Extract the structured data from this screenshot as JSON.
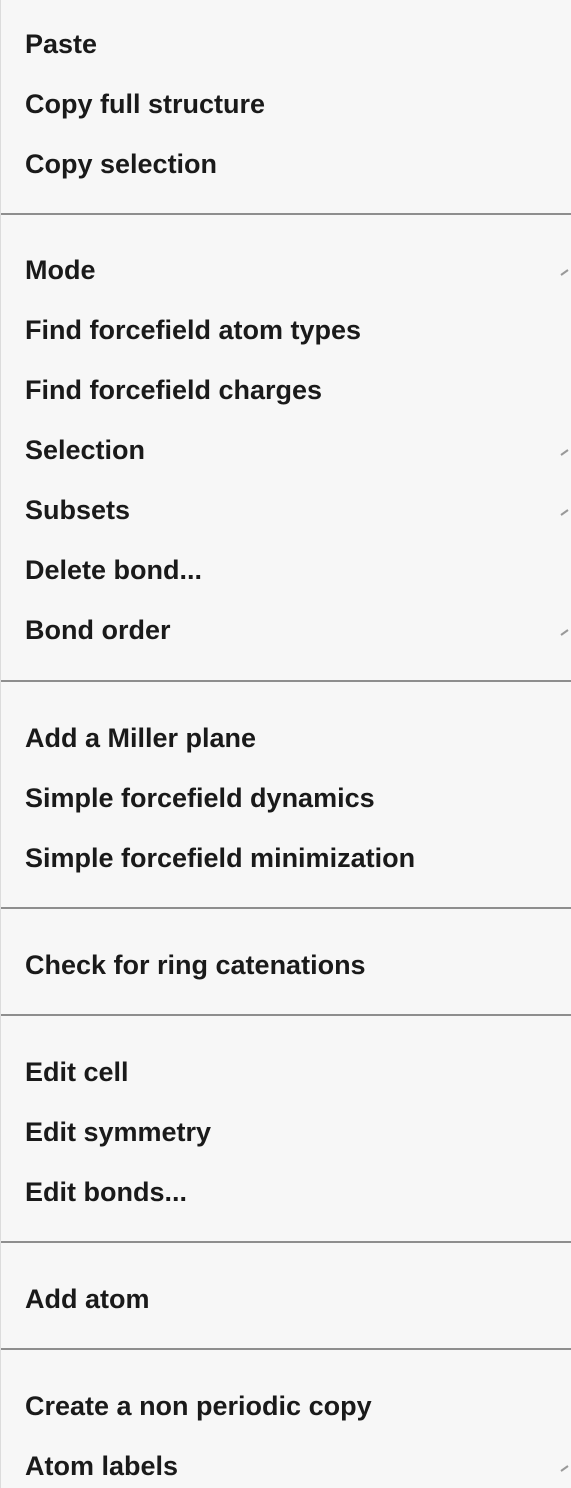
{
  "menu": {
    "items": [
      {
        "label": "Paste",
        "submenu": false
      },
      {
        "label": "Copy full structure",
        "submenu": false
      },
      {
        "label": "Copy selection",
        "submenu": false
      },
      {
        "label": "Mode",
        "submenu": true
      },
      {
        "label": "Find forcefield atom types",
        "submenu": false
      },
      {
        "label": "Find forcefield charges",
        "submenu": false
      },
      {
        "label": "Selection",
        "submenu": true
      },
      {
        "label": "Subsets",
        "submenu": true
      },
      {
        "label": "Delete bond...",
        "submenu": false
      },
      {
        "label": "Bond order",
        "submenu": true
      },
      {
        "label": "Add a Miller plane",
        "submenu": false
      },
      {
        "label": "Simple forcefield dynamics",
        "submenu": false
      },
      {
        "label": "Simple forcefield minimization",
        "submenu": false
      },
      {
        "label": "Check for ring catenations",
        "submenu": false
      },
      {
        "label": "Edit cell",
        "submenu": false
      },
      {
        "label": "Edit symmetry",
        "submenu": false
      },
      {
        "label": "Edit bonds...",
        "submenu": false
      },
      {
        "label": "Add atom",
        "submenu": false
      },
      {
        "label": "Create a non periodic copy",
        "submenu": false
      },
      {
        "label": "Atom labels",
        "submenu": true
      }
    ],
    "submenu_arrow_icon": "chevron-right-icon",
    "colors": {
      "background": "#f7f7f7",
      "text": "#1a1a1a",
      "separator": "#8e8e8e"
    }
  }
}
